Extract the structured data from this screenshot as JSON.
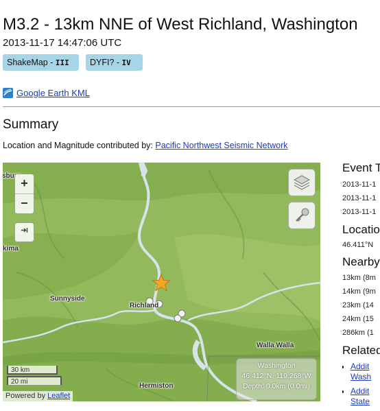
{
  "event": {
    "title": "M3.2 - 13km NNE of West Richland, Washington",
    "time": "2013-11-17 14:47:06 UTC",
    "shakemap": {
      "label": "ShakeMap - ",
      "intensity": "III"
    },
    "dyfi": {
      "label": "DYFI? - ",
      "intensity": "IV"
    }
  },
  "kml": {
    "icon": "google-earth-icon",
    "label": "Google Earth KML"
  },
  "summary": {
    "title": "Summary",
    "contrib_text": "Location and Magnitude contributed by: ",
    "contrib_link": "Pacific Northwest Seismic Network"
  },
  "map": {
    "zoom_in": "+",
    "zoom_out": "−",
    "fullscreen_icon": "fullscreen-icon",
    "layers_icon": "layers-icon",
    "key_icon": "key-icon",
    "places": {
      "top_left": "sburg",
      "left": "kima",
      "sunnyside": "Sunnyside",
      "richland": "Richland",
      "walla_walla": "Walla Walla",
      "hermiston": "Hermiston"
    },
    "scale": {
      "metric": "30 km",
      "imperial": "20 mi"
    },
    "info": {
      "region": "Washington",
      "coords": "46.412°N, 119.268°W",
      "depth": "Depth: 0.0km (0.0mi)"
    },
    "attribution": {
      "text": "Powered by ",
      "link": "Leaflet"
    },
    "colors": {
      "land": "#93b95d",
      "river": "#d7e3ea",
      "epicenter": "#f5a623"
    }
  },
  "aside": {
    "event_time_heading": "Event T",
    "event_times": [
      "2013-11-1",
      "2013-11-1",
      "2013-11-1"
    ],
    "location_heading": "Locatio",
    "location_value": "46.411°N",
    "nearby_heading": "Nearby",
    "nearby": [
      "13km (8m",
      "14km (9m",
      "23km (14",
      "24km (15",
      "286km (1"
    ],
    "related_heading": "Related",
    "related": [
      {
        "line1": "Addit",
        "line2": "Wash"
      },
      {
        "line1": "Addit",
        "line2": "State"
      }
    ]
  }
}
